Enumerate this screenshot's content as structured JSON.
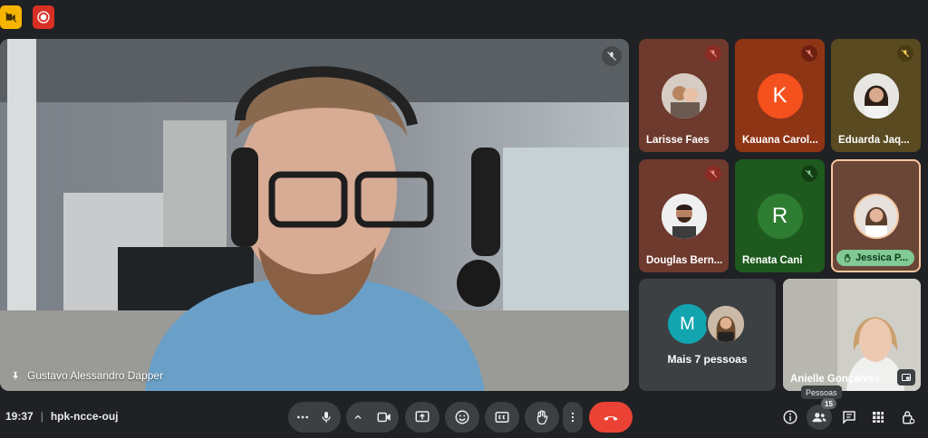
{
  "main_participant": {
    "name": "Gustavo Alessandro Dapper"
  },
  "tiles": [
    {
      "name": "Larisse Faes",
      "avatar": "photo"
    },
    {
      "name": "Kauana Carol...",
      "avatar_letter": "K",
      "avatar_color": "#f4511e"
    },
    {
      "name": "Eduarda Jaq...",
      "avatar": "photo"
    },
    {
      "name": "Douglas Bern...",
      "avatar": "photo"
    },
    {
      "name": "Renata Cani",
      "avatar_letter": "R",
      "avatar_color": "#2e7d32"
    },
    {
      "name": "Jessica P...",
      "avatar": "photo",
      "hand_raised": true
    },
    {
      "name": "Anielle Gonçalves",
      "video": true
    }
  ],
  "more": {
    "label": "Mais 7 pessoas",
    "avatar_letter": "M",
    "avatar_color": "#12a4af"
  },
  "meeting": {
    "time": "19:37",
    "code": "hpk-ncce-ouj"
  },
  "people": {
    "tooltip": "Pessoas",
    "count": "15"
  },
  "colors": {
    "end_call": "#ea4335",
    "recording": "#d93025",
    "camera_badge": "#f5b400",
    "hand_pill": "#81c995"
  },
  "icons": [
    "camera-off-icon",
    "record-icon",
    "mic-off-icon",
    "more-dots-icon",
    "mic-icon",
    "chevron-up-icon",
    "camera-icon",
    "present-icon",
    "emoji-icon",
    "captions-icon",
    "raise-hand-icon",
    "more-vert-icon",
    "end-call-icon",
    "info-icon",
    "people-icon",
    "chat-icon",
    "activities-icon",
    "host-controls-icon"
  ]
}
